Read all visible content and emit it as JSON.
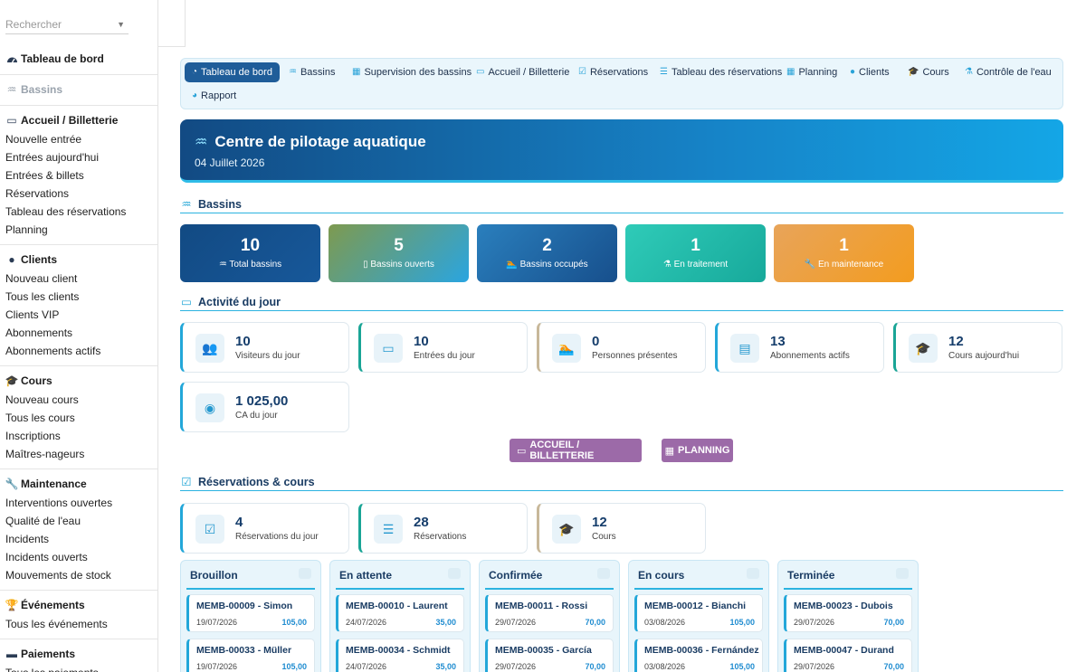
{
  "search": {
    "placeholder": "Rechercher"
  },
  "sidebar": {
    "dashboard": "Tableau de bord",
    "bassins": "Bassins",
    "sections": [
      {
        "title": "Accueil / Billetterie",
        "icon": "ticket-icon",
        "items": [
          "Nouvelle entrée",
          "Entrées aujourd'hui",
          "Entrées & billets",
          "Réservations",
          "Tableau des réservations",
          "Planning"
        ]
      },
      {
        "title": "Clients",
        "icon": "user-icon",
        "items": [
          "Nouveau client",
          "Tous les clients",
          "Clients VIP",
          "Abonnements",
          "Abonnements actifs"
        ]
      },
      {
        "title": "Cours",
        "icon": "graduation-cap-icon",
        "items": [
          "Nouveau cours",
          "Tous les cours",
          "Inscriptions",
          "Maîtres-nageurs"
        ]
      },
      {
        "title": "Maintenance",
        "icon": "wrench-icon",
        "items": [
          "Interventions ouvertes",
          "Qualité de l'eau",
          "Incidents",
          "Incidents ouverts",
          "Mouvements de stock"
        ]
      },
      {
        "title": "Événements",
        "icon": "trophy-icon",
        "items": [
          "Tous les événements"
        ]
      },
      {
        "title": "Paiements",
        "icon": "money-icon",
        "items": [
          "Tous les paiements"
        ]
      }
    ]
  },
  "nav": {
    "tabs": [
      {
        "label": "Tableau de bord",
        "icon": "dashboard-icon",
        "active": true
      },
      {
        "label": "Bassins",
        "icon": "pool-icon"
      },
      {
        "label": "Supervision des bassins",
        "icon": "grid-icon"
      },
      {
        "label": "Accueil / Billetterie",
        "icon": "ticket-icon"
      },
      {
        "label": "Réservations",
        "icon": "calendar-check-icon"
      },
      {
        "label": "Tableau des réservations",
        "icon": "list-icon"
      },
      {
        "label": "Planning",
        "icon": "calendar-icon"
      },
      {
        "label": "Clients",
        "icon": "user-icon"
      },
      {
        "label": "Cours",
        "icon": "graduation-cap-icon"
      },
      {
        "label": "Contrôle de l'eau",
        "icon": "flask-icon"
      },
      {
        "label": "Rapport",
        "icon": "pie-chart-icon"
      }
    ]
  },
  "hero": {
    "title": "Centre de pilotage aquatique",
    "date": "04 Juillet 2026"
  },
  "sections": {
    "bassins": "Bassins",
    "activite": "Activité du jour",
    "reservations": "Réservations & cours"
  },
  "bassin_stats": [
    {
      "value": "10",
      "label": "Total bassins",
      "color": "#14477f"
    },
    {
      "value": "5",
      "label": "Bassins ouverts",
      "color": "#4aa9d8"
    },
    {
      "value": "2",
      "label": "Bassins occupés",
      "color": "#1c6aa6"
    },
    {
      "value": "1",
      "label": "En traitement",
      "color": "#22b8a8"
    },
    {
      "value": "1",
      "label": "En maintenance",
      "color": "#f0a035"
    }
  ],
  "activity": [
    {
      "value": "10",
      "label": "Visiteurs du jour",
      "icon": "users-icon"
    },
    {
      "value": "10",
      "label": "Entrées du jour",
      "icon": "ticket-icon"
    },
    {
      "value": "0",
      "label": "Personnes présentes",
      "icon": "swimmer-icon"
    },
    {
      "value": "13",
      "label": "Abonnements actifs",
      "icon": "id-card-icon"
    },
    {
      "value": "12",
      "label": "Cours aujourd'hui",
      "icon": "graduation-cap-icon"
    },
    {
      "value": "1 025,00",
      "label": "CA du jour",
      "icon": "coins-icon"
    }
  ],
  "buttons": {
    "accueil": "ACCUEIL / BILLETTERIE",
    "planning": "PLANNING"
  },
  "resa_stats": [
    {
      "value": "4",
      "label": "Réservations du jour",
      "icon": "calendar-check-icon"
    },
    {
      "value": "28",
      "label": "Réservations",
      "icon": "list-icon"
    },
    {
      "value": "12",
      "label": "Cours",
      "icon": "graduation-cap-icon"
    }
  ],
  "kanban": [
    {
      "title": "Brouillon",
      "cards": [
        {
          "title": "MEMB-00009 - Simon",
          "date": "19/07/2026",
          "amount": "105,00"
        },
        {
          "title": "MEMB-00033 - Müller",
          "date": "19/07/2026",
          "amount": "105,00"
        }
      ]
    },
    {
      "title": "En attente",
      "cards": [
        {
          "title": "MEMB-00010 - Laurent",
          "date": "24/07/2026",
          "amount": "35,00"
        },
        {
          "title": "MEMB-00034 - Schmidt",
          "date": "24/07/2026",
          "amount": "35,00"
        }
      ]
    },
    {
      "title": "Confirmée",
      "cards": [
        {
          "title": "MEMB-00011 - Rossi",
          "date": "29/07/2026",
          "amount": "70,00"
        },
        {
          "title": "MEMB-00035 - García",
          "date": "29/07/2026",
          "amount": "70,00"
        }
      ]
    },
    {
      "title": "En cours",
      "cards": [
        {
          "title": "MEMB-00012 - Bianchi",
          "date": "03/08/2026",
          "amount": "105,00"
        },
        {
          "title": "MEMB-00036 - Fernández",
          "date": "03/08/2026",
          "amount": "105,00"
        }
      ]
    },
    {
      "title": "Terminée",
      "cards": [
        {
          "title": "MEMB-00023 - Dubois",
          "date": "29/07/2026",
          "amount": "70,00"
        },
        {
          "title": "MEMB-00047 - Durand",
          "date": "29/07/2026",
          "amount": "70,00"
        }
      ]
    }
  ]
}
